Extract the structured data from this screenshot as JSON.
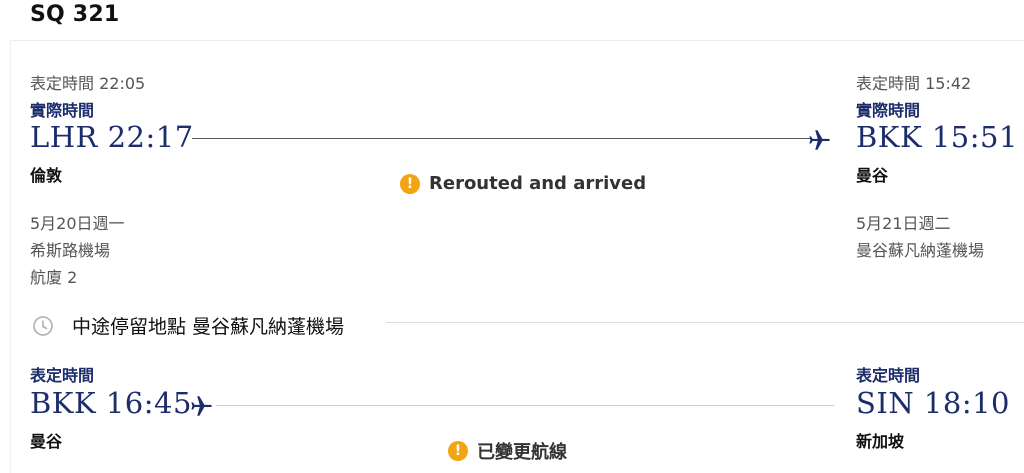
{
  "flight": {
    "number": "SQ 321"
  },
  "segment1": {
    "origin": {
      "scheduled": "表定時間 22:05",
      "actual_label": "實際時間",
      "code_time": "LHR 22:17",
      "city": "倫敦",
      "date": "5月20日週一",
      "airport": "希斯路機場",
      "terminal": "航廈 2"
    },
    "destination": {
      "scheduled": "表定時間 15:42",
      "actual_label": "實際時間",
      "code_time": "BKK 15:51",
      "city": "曼谷",
      "date": "5月21日週二",
      "airport": "曼谷蘇凡納蓬機場"
    },
    "status": "Rerouted and arrived",
    "status_icon": "!"
  },
  "stopover": {
    "text": "中途停留地點 曼谷蘇凡納蓬機場"
  },
  "segment2": {
    "origin": {
      "scheduled_label": "表定時間",
      "code_time": "BKK 16:45",
      "city": "曼谷"
    },
    "destination": {
      "scheduled_label": "表定時間",
      "code_time": "SIN 18:10",
      "city": "新加坡"
    },
    "status": "已變更航線",
    "status_icon": "!"
  },
  "colors": {
    "brand_navy": "#1c2d6b",
    "warning": "#f2a413"
  }
}
